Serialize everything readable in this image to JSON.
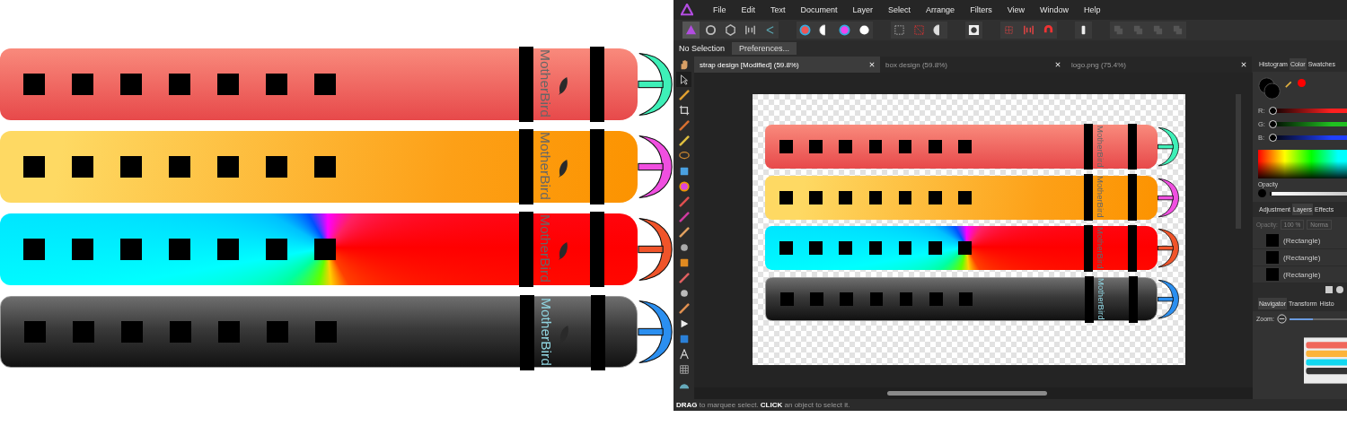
{
  "preview": {
    "straps": [
      {
        "kind": "coral",
        "color": "#3ef0b8",
        "logo": "MotherBird"
      },
      {
        "kind": "amber",
        "color": "#f04fe0",
        "logo": "MotherBird"
      },
      {
        "kind": "spectrum",
        "color": "#f0542a",
        "logo": "MotherBird"
      },
      {
        "kind": "graphite",
        "color": "#2b8ff0",
        "logo": "MotherBird"
      }
    ]
  },
  "app": {
    "menu": [
      "File",
      "Edit",
      "Text",
      "Document",
      "Layer",
      "Select",
      "Arrange",
      "Filters",
      "View",
      "Window",
      "Help"
    ],
    "context_bar": {
      "selection": "No Selection",
      "button": "Preferences..."
    },
    "doc_tabs": [
      {
        "label": "strap design [Modified] (59.8%)",
        "selected": true
      },
      {
        "label": "box design (59.8%)",
        "selected": false
      },
      {
        "label": "logo.png (75.4%)",
        "selected": false
      }
    ],
    "canvas": {
      "straps": [
        {
          "kind": "coral",
          "color": "#3ef0b8",
          "logo": "MotherBird"
        },
        {
          "kind": "amber",
          "color": "#f04fe0",
          "logo": "MotherBird"
        },
        {
          "kind": "spectrum",
          "color": "#f0542a",
          "logo": "MotherBird"
        },
        {
          "kind": "graphite",
          "color": "#2b8ff0",
          "logo": "MotherBird"
        }
      ]
    },
    "color_panel": {
      "tabs": [
        {
          "label": "Histogram",
          "selected": false
        },
        {
          "label": "Color",
          "selected": true
        },
        {
          "label": "Swatches",
          "selected": false
        }
      ],
      "sliders": [
        {
          "label": "R:",
          "level": 0,
          "color": "#ff2020"
        },
        {
          "label": "G:",
          "level": 0,
          "color": "#20c020"
        },
        {
          "label": "B:",
          "level": 0,
          "color": "#2040ff"
        }
      ],
      "opacity_label": "Opacity",
      "opacity_slider": {
        "level": 0.02
      }
    },
    "layers_panel": {
      "tabs": [
        {
          "label": "Adjustment",
          "selected": false
        },
        {
          "label": "Layers",
          "selected": true
        },
        {
          "label": "Effects",
          "selected": false
        }
      ],
      "opacity_label": "Opacity:",
      "opacity_value": "100 %",
      "blend_mode": "Norma",
      "rows": [
        "(Rectangle)",
        "(Rectangle)",
        "(Rectangle)"
      ]
    },
    "navigator_panel": {
      "tabs": [
        {
          "label": "Navigator",
          "selected": true
        },
        {
          "label": "Transform",
          "selected": false
        },
        {
          "label": "Histo",
          "selected": false
        }
      ],
      "zoom_label": "Zoom:",
      "zoom_slider": {
        "level": 0.4
      }
    },
    "status_bar": "**DRAG** to marquee select. **CLICK** an object to select it."
  }
}
